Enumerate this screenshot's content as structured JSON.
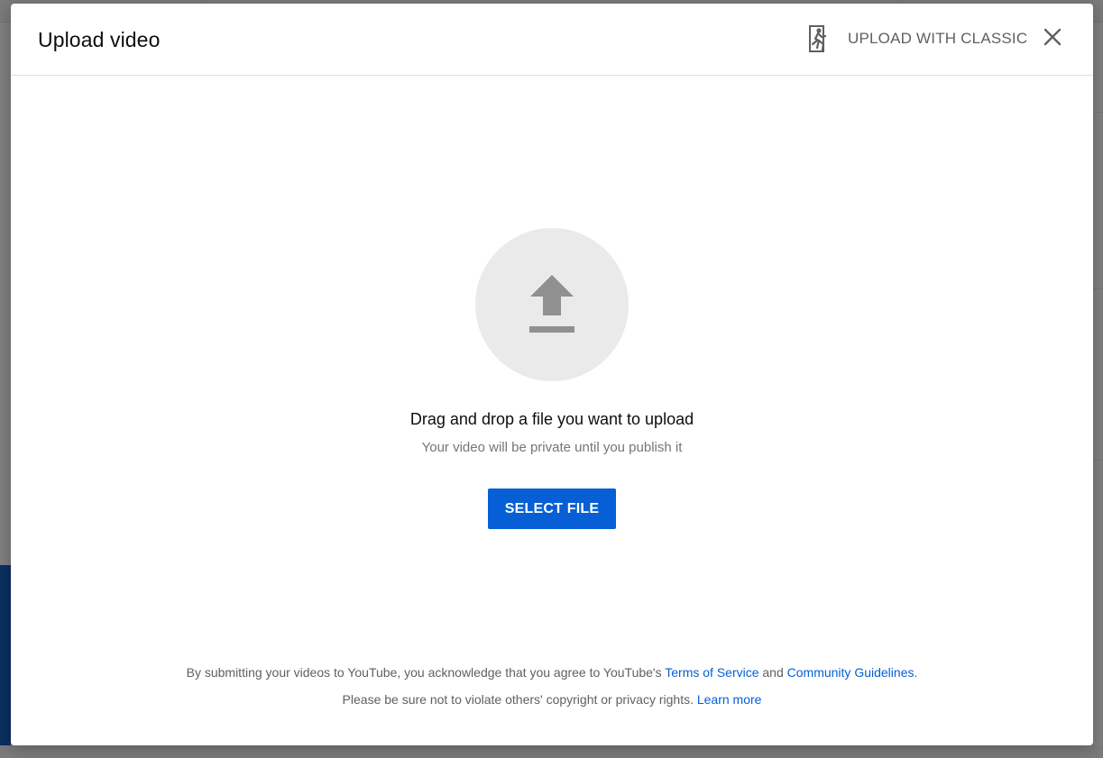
{
  "modal": {
    "title": "Upload video",
    "classic_label": "UPLOAD WITH CLASSIC",
    "classic_icon": "exit-classic-icon",
    "close_icon": "close-icon"
  },
  "upload": {
    "icon": "upload-arrow-icon",
    "drag_text": "Drag and drop a file you want to upload",
    "privacy_note": "Your video will be private until you publish it",
    "select_button": "SELECT FILE"
  },
  "footer": {
    "line1_prefix": "By submitting your videos to YouTube, you acknowledge that you agree to YouTube's ",
    "terms_link": "Terms of Service",
    "line1_and": " and ",
    "guidelines_link": "Community Guidelines",
    "line1_suffix": ".",
    "line2_prefix": "Please be sure not to violate others' copyright or privacy rights. ",
    "learn_more_link": "Learn more"
  },
  "colors": {
    "accent": "#065fd4",
    "overlay": "#7f7f7f",
    "icon_gray": "#909090"
  }
}
